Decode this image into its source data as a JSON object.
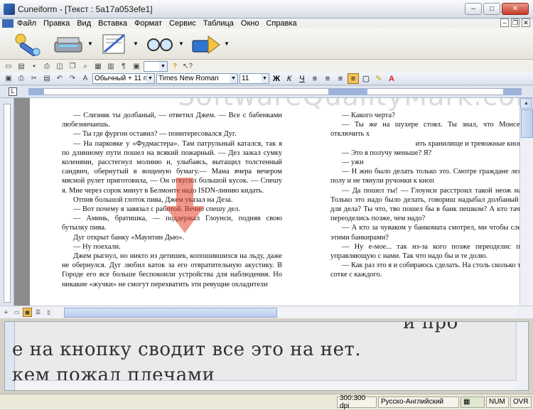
{
  "window": {
    "title": "Cuneiform - [Текст : 5a17a053efe1]"
  },
  "menu": [
    "Файл",
    "Правка",
    "Вид",
    "Вставка",
    "Формат",
    "Сервис",
    "Таблица",
    "Окно",
    "Справка"
  ],
  "format_bar": {
    "style": "Обычный + 11 пт,",
    "font": "Times New Roman",
    "size": "11"
  },
  "document": {
    "col1": [
      "— Слизняк ты долбаный, — ответил Джем. — Все с бабенками любезничаешь.",
      "— Ты где фургон оставил? — поинтересовался Дуг.",
      "— На парковке у «Фудмастера». Там патрульный катался, так я по длинному пути пошел на всякий пожарный. — Дез зажал сумку коленями, расстегнул молнию и, улыбаясь, вытащил толстенный сандвич, обернутый в вощеную бумагу.— Мама вчера вечером мясной рулет приготовила, — Он откусил большой кусок. — Спешу я. Мне через сорок минут в Белмонте надо ISDN-линию кидать.",
      "Отпив большой глоток пива, Джем указал на Деза.",
      "— Вот почему я завязал с работой. Вечно спешу дел.",
      "— Аминь, братишка, — поддержал Глоунси, подняв свою бутылку пива.",
      "Дуг открыт банку «Маунтин Дью».",
      "— Ну поехали.",
      "Джем рыгнул, но никто из детишек, копошившихся на льду, даже не обернулся. Дуг любил каток за его отвратительную акустику. В Городе его все больше беспокоили устройства для наблюдения. Но никакие «жучки» не смогут перехватить эти ревущие охладители"
    ],
    "col2": [
      "— Какого черта?",
      "— Ты же на шухере стоял. Ты знал, что Монсен смог отключить х",
      "ить хранилище и тревожные кнопки в ка",
      "— Это я получу меньше? Я?",
      "— ужн",
      "— Н жно было делать только это. Смотре граждане лежали на полу и не тянули ручонки к кноп",
      "— Да пошел ты! — Глоунси расстроил такой неож наезд. — Только это надо было делать, говориш надыбал долбаный фургон для дела? Ты что, тво пошел бы в банк пешком? А кто тачку спал переоделись позже, чем надо?",
      "— А кто за чуваком у банкомата смотрел, ми чтобы следить за этими банкирами?",
      "— Ну е-мое... так из-за кого позже переоделис потащил управляющую с нами. Так что надо бы и те долю.",
      "— Как раз это я и собираюсь сделать. На столь сколько тебе. По сотке с каждого."
    ]
  },
  "watermark": "SoftwareQualityMark.com",
  "image_preview": {
    "line_top": "и про",
    "line_main": "е на кнопку сводит все это на нет.",
    "line_bottom": "кем пожал плечами"
  },
  "status": {
    "dpi": "300:300 dpi",
    "language": "Русско-Английский",
    "num": "NUM",
    "ovr": "OVR"
  },
  "colors": {
    "accent": "#e8422e",
    "page": "#ffffff",
    "background": "#8c8c8c"
  }
}
